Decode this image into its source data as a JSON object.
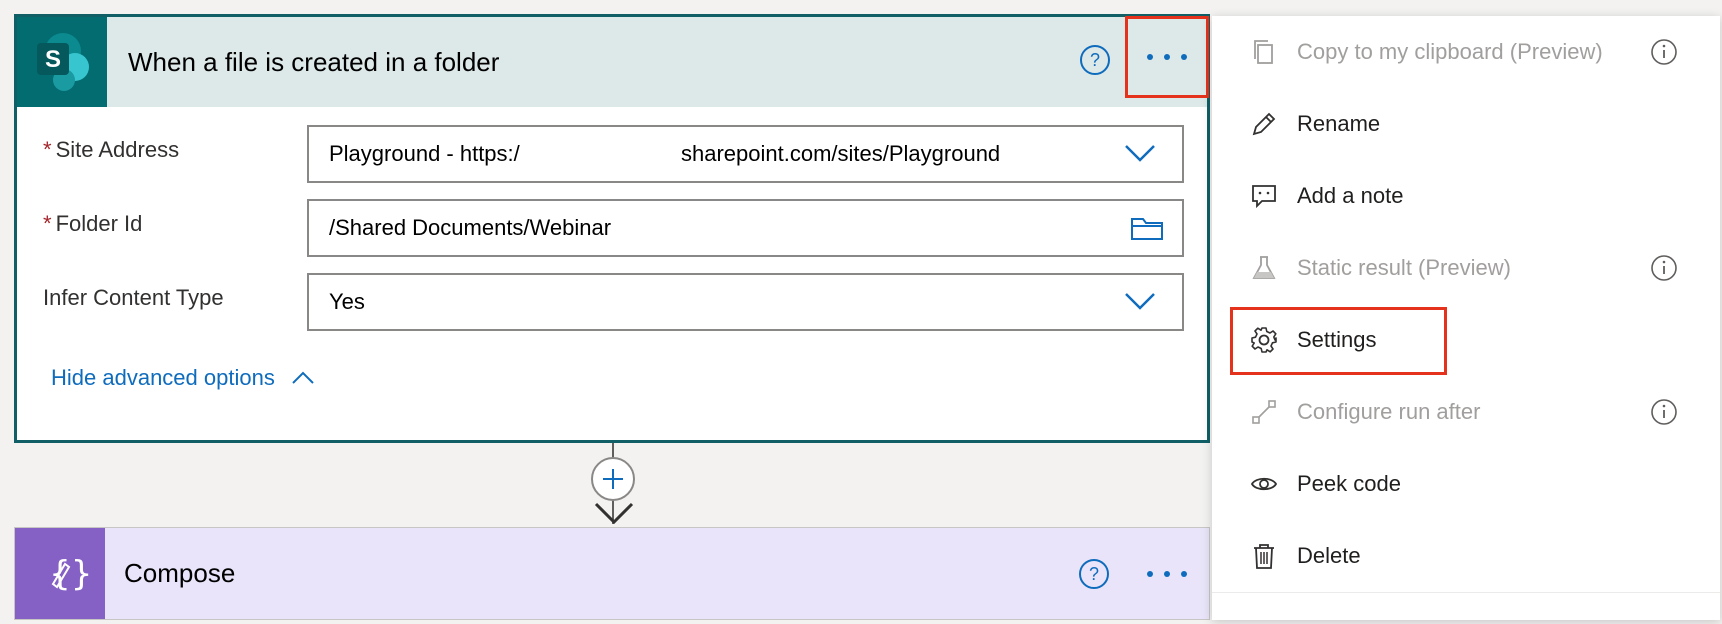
{
  "trigger": {
    "title": "When a file is created in a folder",
    "logo_letter": "S",
    "fields": [
      {
        "label": "Site Address",
        "required": true,
        "value": "Playground - https:/",
        "value_tail": "sharepoint.com/sites/Playground",
        "control": "dropdown"
      },
      {
        "label": "Folder Id",
        "required": true,
        "value": "/Shared Documents/Webinar",
        "control": "folder-picker"
      },
      {
        "label": "Infer Content Type",
        "required": false,
        "value": "Yes",
        "control": "dropdown"
      }
    ],
    "required_marker": "*",
    "advanced_link": "Hide advanced options"
  },
  "compose": {
    "title": "Compose"
  },
  "menu": {
    "items": [
      {
        "label": "Copy to my clipboard (Preview)",
        "icon": "copy-icon",
        "disabled": true,
        "info": true
      },
      {
        "label": "Rename",
        "icon": "pencil-icon",
        "disabled": false,
        "info": false
      },
      {
        "label": "Add a note",
        "icon": "note-icon",
        "disabled": false,
        "info": false
      },
      {
        "label": "Static result (Preview)",
        "icon": "flask-icon",
        "disabled": true,
        "info": true
      },
      {
        "label": "Settings",
        "icon": "gear-icon",
        "disabled": false,
        "info": false,
        "highlighted": true
      },
      {
        "label": "Configure run after",
        "icon": "run-after-icon",
        "disabled": true,
        "info": true
      },
      {
        "label": "Peek code",
        "icon": "eye-icon",
        "disabled": false,
        "info": false
      },
      {
        "label": "Delete",
        "icon": "trash-icon",
        "disabled": false,
        "info": false
      }
    ]
  },
  "colors": {
    "trigger_border": "#105f66",
    "trigger_header_bg": "#dde8e8",
    "sharepoint_logo_bg": "#036c70",
    "compose_bg": "#e9e4f9",
    "compose_logo_bg": "#8661c5",
    "link_blue": "#0f6cbd",
    "highlight_red": "#e5321c",
    "required_red": "#a4262c"
  }
}
